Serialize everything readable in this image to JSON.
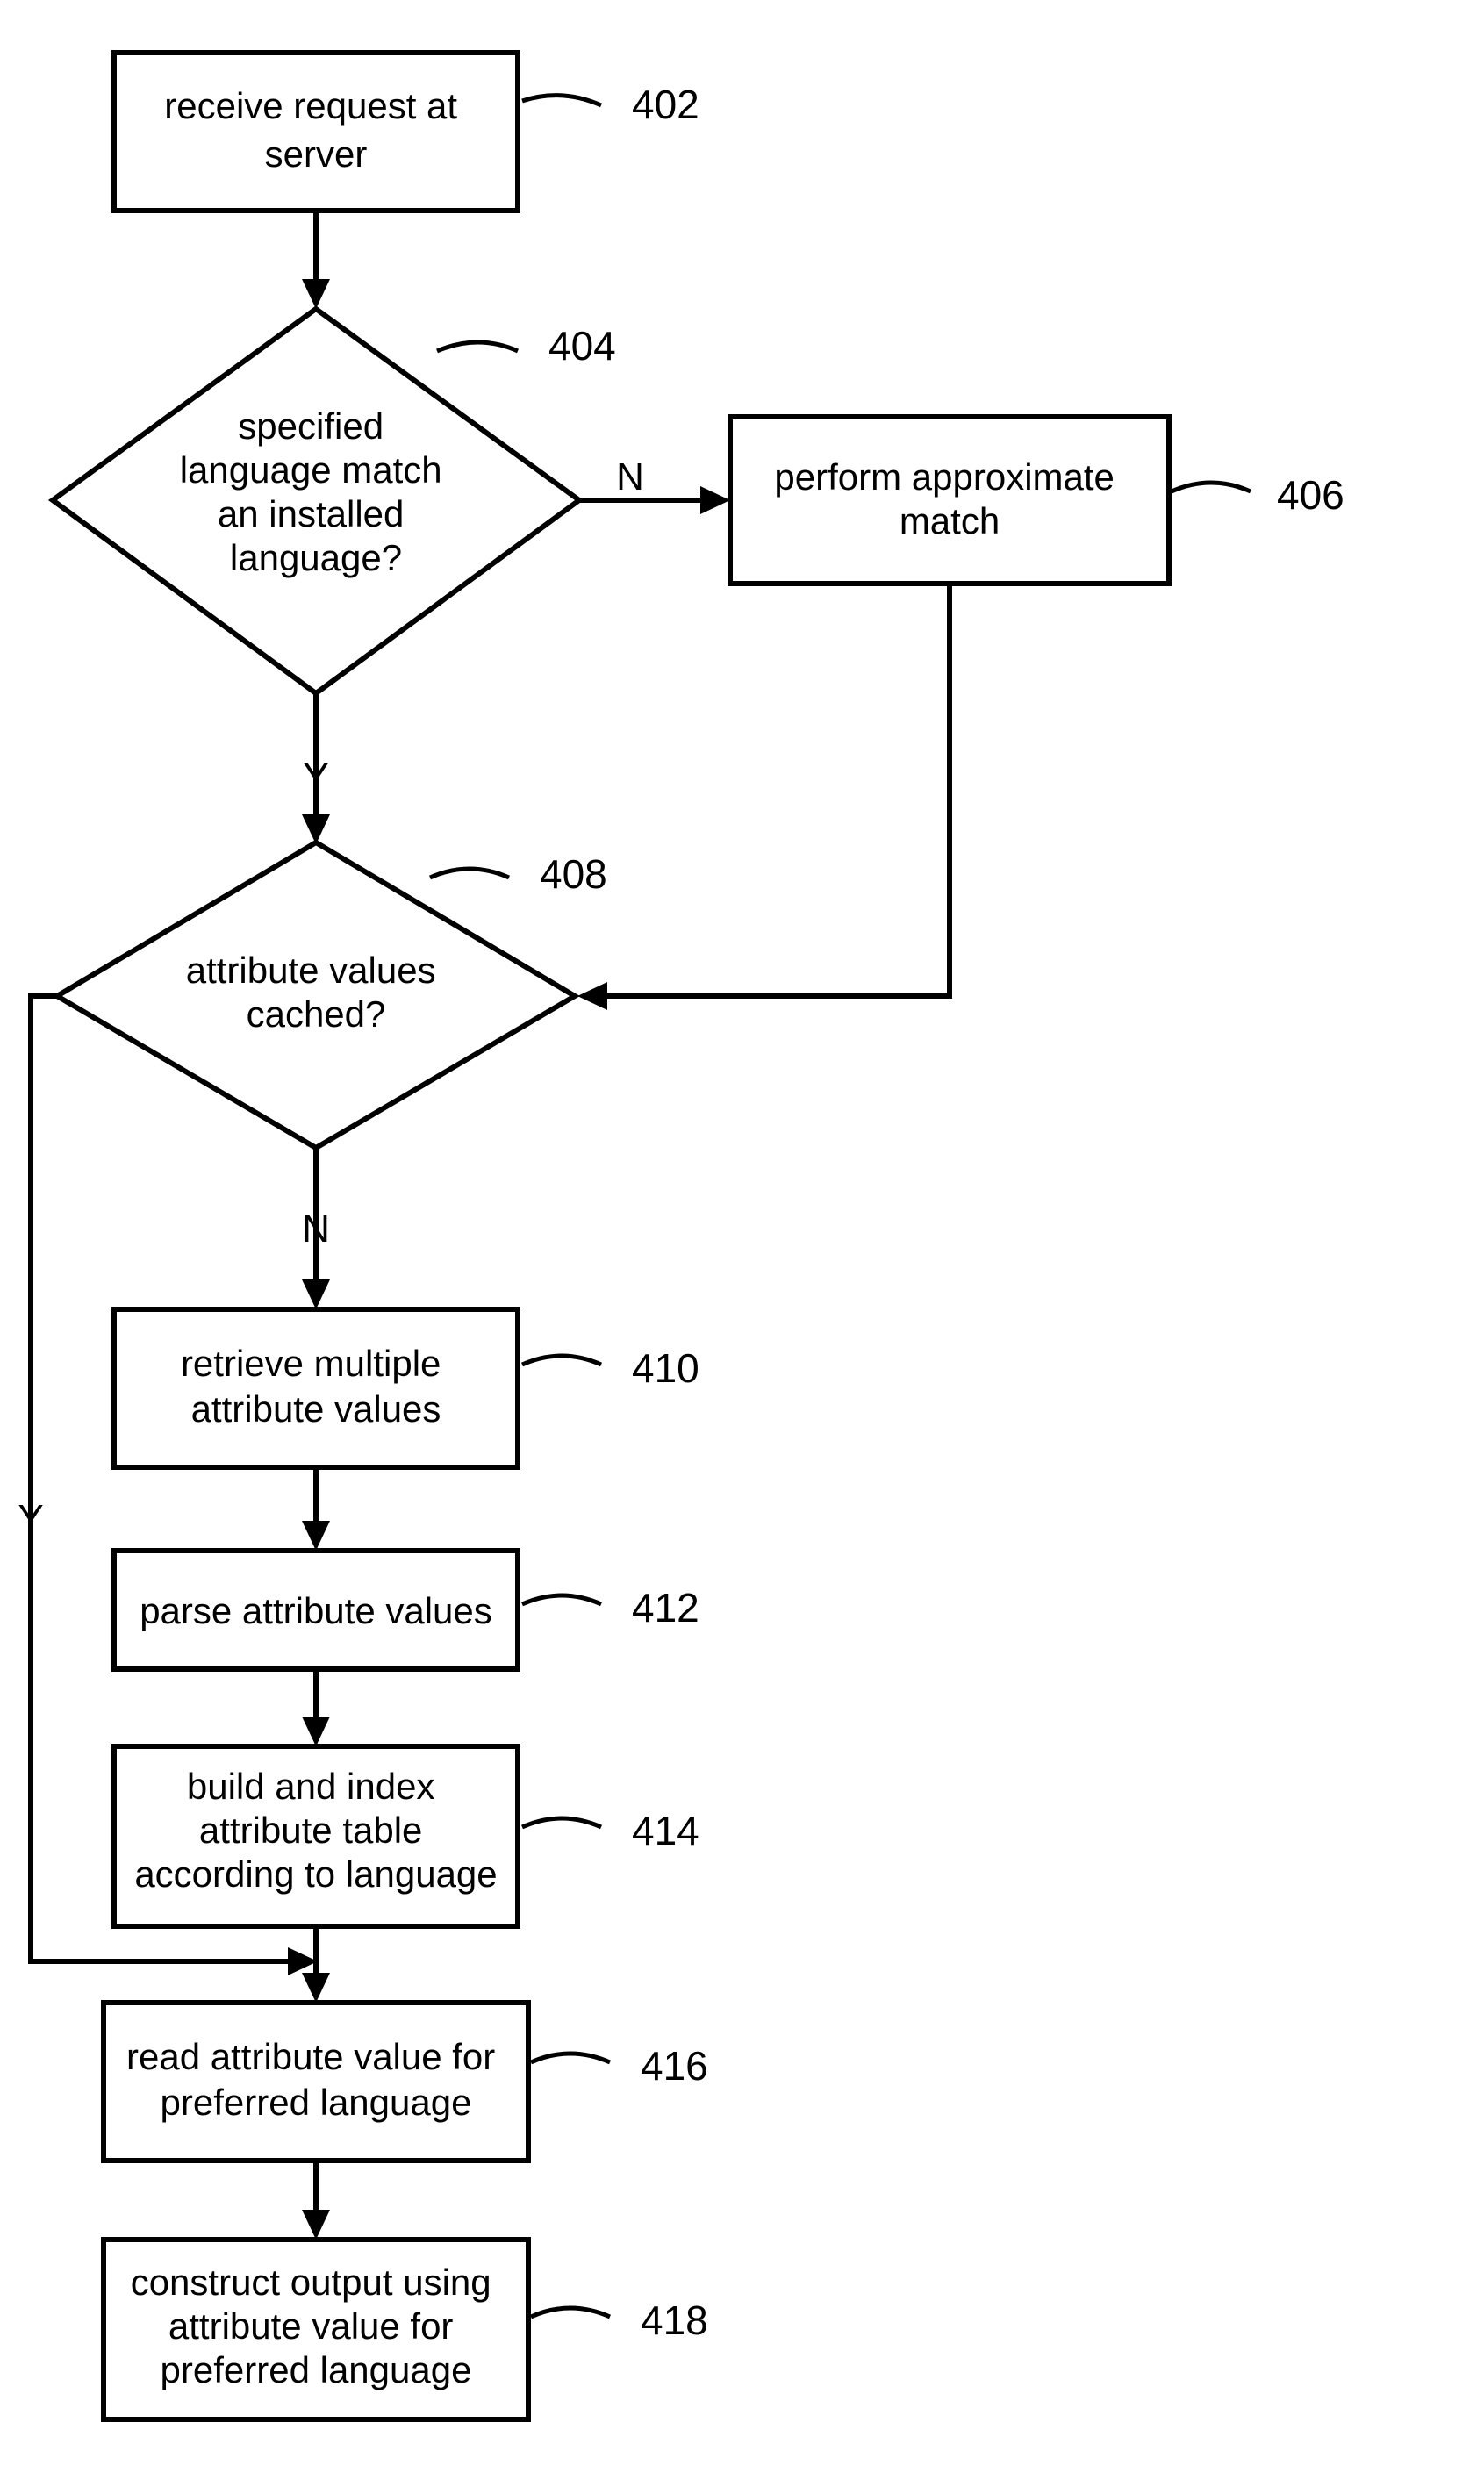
{
  "chart_data": {
    "type": "flowchart",
    "nodes": [
      {
        "id": "402",
        "kind": "process",
        "label": "402",
        "text": [
          "receive request at",
          "server"
        ]
      },
      {
        "id": "404",
        "kind": "decision",
        "label": "404",
        "text": [
          "specified",
          "language match",
          "an installed",
          "language?"
        ]
      },
      {
        "id": "406",
        "kind": "process",
        "label": "406",
        "text": [
          "perform approximate",
          "match"
        ]
      },
      {
        "id": "408",
        "kind": "decision",
        "label": "408",
        "text": [
          "attribute values",
          "cached?"
        ]
      },
      {
        "id": "410",
        "kind": "process",
        "label": "410",
        "text": [
          "retrieve multiple",
          "attribute values"
        ]
      },
      {
        "id": "412",
        "kind": "process",
        "label": "412",
        "text": [
          "parse attribute values"
        ]
      },
      {
        "id": "414",
        "kind": "process",
        "label": "414",
        "text": [
          "build and index",
          "attribute table",
          "according to language"
        ]
      },
      {
        "id": "416",
        "kind": "process",
        "label": "416",
        "text": [
          "read attribute value for",
          "preferred language"
        ]
      },
      {
        "id": "418",
        "kind": "process",
        "label": "418",
        "text": [
          "construct output using",
          "attribute value for",
          "preferred language"
        ]
      }
    ],
    "edges": [
      {
        "from": "402",
        "to": "404",
        "label": ""
      },
      {
        "from": "404",
        "to": "406",
        "label": "N"
      },
      {
        "from": "404",
        "to": "408",
        "label": "Y"
      },
      {
        "from": "406",
        "to": "408",
        "label": ""
      },
      {
        "from": "408",
        "to": "410",
        "label": "N"
      },
      {
        "from": "408",
        "to": "416",
        "label": "Y"
      },
      {
        "from": "410",
        "to": "412",
        "label": ""
      },
      {
        "from": "412",
        "to": "414",
        "label": ""
      },
      {
        "from": "414",
        "to": "416",
        "label": ""
      },
      {
        "from": "416",
        "to": "418",
        "label": ""
      }
    ]
  }
}
